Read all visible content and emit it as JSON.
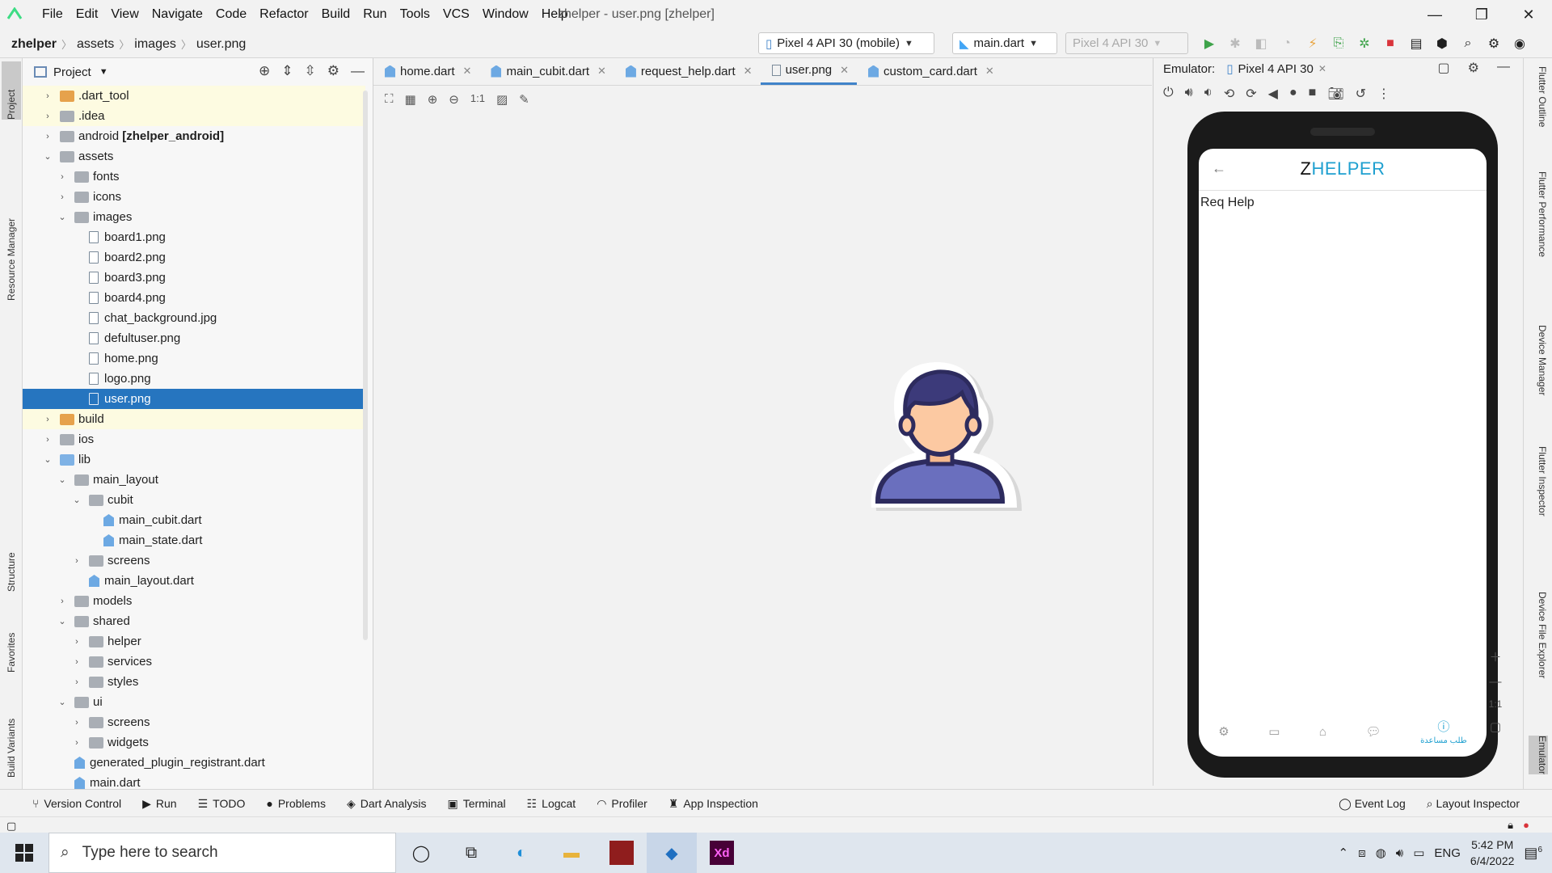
{
  "menubar": {
    "items": [
      "File",
      "Edit",
      "View",
      "Navigate",
      "Code",
      "Refactor",
      "Build",
      "Run",
      "Tools",
      "VCS",
      "Window",
      "Help"
    ],
    "window_title": "zhelper - user.png [zhelper]"
  },
  "navbar": {
    "breadcrumbs": [
      "zhelper",
      "assets",
      "images",
      "user.png"
    ],
    "device_selector": "Pixel 4 API 30 (mobile)",
    "run_config": "main.dart",
    "device_disabled": "Pixel 4 API 30"
  },
  "leftstrip": {
    "tabs": [
      "Project",
      "Resource Manager",
      "Structure",
      "Favorites",
      "Build Variants"
    ]
  },
  "project": {
    "title": "Project",
    "tree": [
      {
        "label": ".dart_tool",
        "indent": 0,
        "arrow": "›",
        "icon": "folder-orange",
        "hl": true
      },
      {
        "label": ".idea",
        "indent": 0,
        "arrow": "›",
        "icon": "folder",
        "hl": true
      },
      {
        "label": "android",
        "extra": " [zhelper_android]",
        "indent": 0,
        "arrow": "›",
        "icon": "folder",
        "hl": false
      },
      {
        "label": "assets",
        "indent": 0,
        "arrow": "⌄",
        "icon": "folder",
        "hl": false
      },
      {
        "label": "fonts",
        "indent": 1,
        "arrow": "›",
        "icon": "folder",
        "hl": false
      },
      {
        "label": "icons",
        "indent": 1,
        "arrow": "›",
        "icon": "folder",
        "hl": false
      },
      {
        "label": "images",
        "indent": 1,
        "arrow": "⌄",
        "icon": "folder",
        "hl": false
      },
      {
        "label": "board1.png",
        "indent": 2,
        "arrow": "",
        "icon": "file",
        "hl": false
      },
      {
        "label": "board2.png",
        "indent": 2,
        "arrow": "",
        "icon": "file",
        "hl": false
      },
      {
        "label": "board3.png",
        "indent": 2,
        "arrow": "",
        "icon": "file",
        "hl": false
      },
      {
        "label": "board4.png",
        "indent": 2,
        "arrow": "",
        "icon": "file",
        "hl": false
      },
      {
        "label": "chat_background.jpg",
        "indent": 2,
        "arrow": "",
        "icon": "file",
        "hl": false
      },
      {
        "label": "defultuser.png",
        "indent": 2,
        "arrow": "",
        "icon": "file",
        "hl": false
      },
      {
        "label": "home.png",
        "indent": 2,
        "arrow": "",
        "icon": "file",
        "hl": false
      },
      {
        "label": "logo.png",
        "indent": 2,
        "arrow": "",
        "icon": "file",
        "hl": false
      },
      {
        "label": "user.png",
        "indent": 2,
        "arrow": "",
        "icon": "file",
        "hl": false,
        "sel": true
      },
      {
        "label": "build",
        "indent": 0,
        "arrow": "›",
        "icon": "folder-orange",
        "hl": true
      },
      {
        "label": "ios",
        "indent": 0,
        "arrow": "›",
        "icon": "folder",
        "hl": false
      },
      {
        "label": "lib",
        "indent": 0,
        "arrow": "⌄",
        "icon": "folder-blue",
        "hl": false
      },
      {
        "label": "main_layout",
        "indent": 1,
        "arrow": "⌄",
        "icon": "folder",
        "hl": false
      },
      {
        "label": "cubit",
        "indent": 2,
        "arrow": "⌄",
        "icon": "folder",
        "hl": false
      },
      {
        "label": "main_cubit.dart",
        "indent": 3,
        "arrow": "",
        "icon": "dart",
        "hl": false
      },
      {
        "label": "main_state.dart",
        "indent": 3,
        "arrow": "",
        "icon": "dart",
        "hl": false
      },
      {
        "label": "screens",
        "indent": 2,
        "arrow": "›",
        "icon": "folder",
        "hl": false
      },
      {
        "label": "main_layout.dart",
        "indent": 2,
        "arrow": "",
        "icon": "dart",
        "hl": false
      },
      {
        "label": "models",
        "indent": 1,
        "arrow": "›",
        "icon": "folder",
        "hl": false
      },
      {
        "label": "shared",
        "indent": 1,
        "arrow": "⌄",
        "icon": "folder",
        "hl": false
      },
      {
        "label": "helper",
        "indent": 2,
        "arrow": "›",
        "icon": "folder",
        "hl": false
      },
      {
        "label": "services",
        "indent": 2,
        "arrow": "›",
        "icon": "folder",
        "hl": false
      },
      {
        "label": "styles",
        "indent": 2,
        "arrow": "›",
        "icon": "folder",
        "hl": false
      },
      {
        "label": "ui",
        "indent": 1,
        "arrow": "⌄",
        "icon": "folder",
        "hl": false
      },
      {
        "label": "screens",
        "indent": 2,
        "arrow": "›",
        "icon": "folder",
        "hl": false
      },
      {
        "label": "widgets",
        "indent": 2,
        "arrow": "›",
        "icon": "folder",
        "hl": false
      },
      {
        "label": "generated_plugin_registrant.dart",
        "indent": 1,
        "arrow": "",
        "icon": "dart",
        "hl": false
      },
      {
        "label": "main.dart",
        "indent": 1,
        "arrow": "",
        "icon": "dart",
        "hl": false
      }
    ]
  },
  "editor": {
    "tabs": [
      {
        "label": "home.dart",
        "type": "dart",
        "active": false
      },
      {
        "label": "main_cubit.dart",
        "type": "dart",
        "active": false
      },
      {
        "label": "request_help.dart",
        "type": "dart",
        "active": false
      },
      {
        "label": "user.png",
        "type": "png",
        "active": true
      },
      {
        "label": "custom_card.dart",
        "type": "dart",
        "active": false
      }
    ],
    "image_toolbar_ratio": "1:1"
  },
  "emulator": {
    "label": "Emulator:",
    "device_tab": "Pixel 4 API 30",
    "app": {
      "logo_z": "Z",
      "logo_rest": "HELPER",
      "body_text": "Req Help",
      "active_nav_label": "طلب مساعدة"
    },
    "zoom_ratio": "1:1"
  },
  "rightstrip": {
    "tabs": [
      "Flutter Outline",
      "Flutter Performance",
      "Device Manager",
      "Flutter Inspector",
      "Device File Explorer",
      "Emulator"
    ]
  },
  "bottombar": {
    "items": [
      "Version Control",
      "Run",
      "TODO",
      "Problems",
      "Dart Analysis",
      "Terminal",
      "Logcat",
      "Profiler",
      "App Inspection"
    ],
    "right_items": [
      "Event Log",
      "Layout Inspector"
    ]
  },
  "taskbar": {
    "search_placeholder": "Type here to search",
    "language": "ENG",
    "time": "5:42 PM",
    "date": "6/4/2022",
    "notification_count": "6"
  },
  "colors": {
    "accent": "#2675bf",
    "app_blue": "#1fa0d0",
    "highlight_row": "#fdfbe1"
  }
}
